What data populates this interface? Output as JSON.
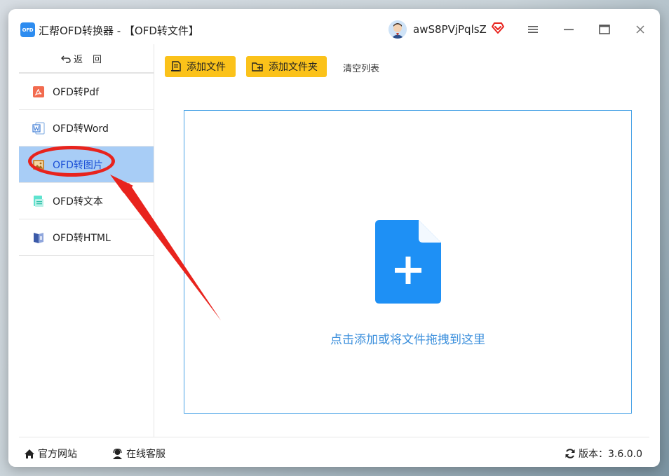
{
  "window": {
    "logo_text": "OFD",
    "title": "汇帮OFD转换器 - 【OFD转文件】",
    "username": "awS8PVjPqlsZ"
  },
  "sidebar": {
    "back_label": "返回",
    "items": [
      {
        "label": "OFD转Pdf",
        "icon": "pdf-icon"
      },
      {
        "label": "OFD转Word",
        "icon": "word-icon"
      },
      {
        "label": "OFD转图片",
        "icon": "image-icon",
        "active": true
      },
      {
        "label": "OFD转文本",
        "icon": "text-icon"
      },
      {
        "label": "OFD转HTML",
        "icon": "html-icon"
      }
    ]
  },
  "toolbar": {
    "add_file_label": "添加文件",
    "add_folder_label": "添加文件夹",
    "clear_label": "清空列表"
  },
  "dropzone": {
    "hint": "点击添加或将文件拖拽到这里"
  },
  "footer": {
    "website_label": "官方网站",
    "support_label": "在线客服",
    "version_label": "版本：3.6.0.0"
  },
  "colors": {
    "accent": "#2d8cf0",
    "toolbar_button": "#fbc21a",
    "active_item_bg": "#a8cdf6",
    "active_item_text": "#1a4fd6",
    "annotation_red": "#e8231d",
    "drop_icon": "#1e90f5"
  }
}
